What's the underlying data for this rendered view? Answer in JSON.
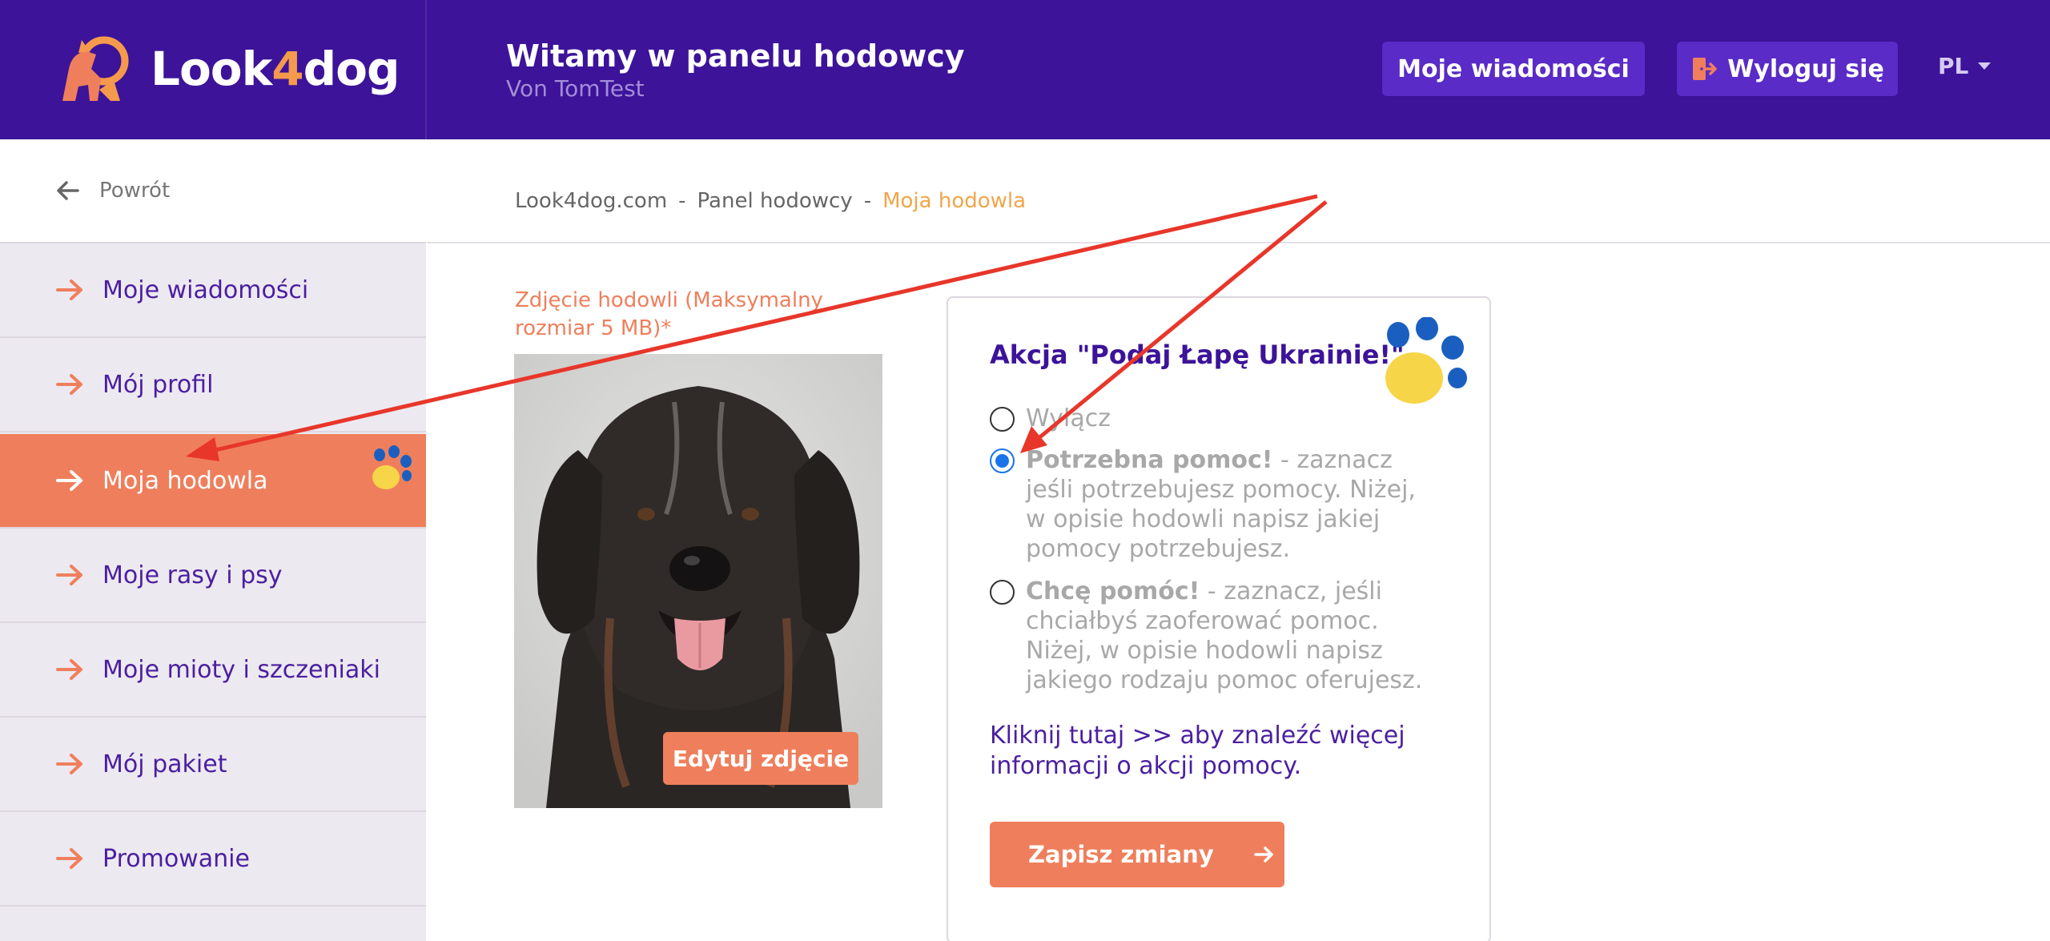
{
  "header": {
    "logo_text_a": "Look",
    "logo_text_b": "4",
    "logo_text_c": "dog",
    "welcome_title": "Witamy w panelu hodowcy",
    "welcome_sub": "Von TomTest",
    "messages_button": "Moje wiadomości",
    "logout_button": "Wyloguj się",
    "language": "PL"
  },
  "sidebar": {
    "back_label": "Powrót",
    "items": [
      {
        "label": "Moje wiadomości"
      },
      {
        "label": "Mój profil"
      },
      {
        "label": "Moja hodowla"
      },
      {
        "label": "Moje rasy i psy"
      },
      {
        "label": "Moje mioty i szczeniaki"
      },
      {
        "label": "Mój pakiet"
      },
      {
        "label": "Promowanie"
      }
    ]
  },
  "breadcrumb": {
    "items": [
      "Look4dog.com",
      "-",
      "Panel hodowcy",
      "-"
    ],
    "current": "Moja hodowla"
  },
  "photo": {
    "label": "Zdjęcie hodowli (Maksymalny rozmiar 5 MB)*",
    "edit_button": "Edytuj zdjęcie"
  },
  "ukraine_card": {
    "title": "Akcja \"Podaj Łapę Ukrainie!\"",
    "options": [
      {
        "bold": "",
        "text": "Wyłącz",
        "checked": false
      },
      {
        "bold": "Potrzebna pomoc!",
        "text": " - zaznacz jeśli potrzebujesz pomocy. Niżej, w opisie hodowli napisz jakiej pomocy potrzebujesz.",
        "checked": true
      },
      {
        "bold": "Chcę pomóc!",
        "text": " - zaznacz, jeśli chciałbyś zaoferować pomoc. Niżej, w opisie hodowli napisz jakiego rodzaju pomoc oferujesz.",
        "checked": false
      }
    ],
    "more_link": "Kliknij tutaj >> aby znaleźć więcej informacji o akcji pomocy.",
    "save_button": "Zapisz zmiany"
  },
  "colors": {
    "header_bg": "#3c1399",
    "accent_orange": "#ef7f5c",
    "nav_text": "#4a1fa0",
    "breadcrumb_current": "#f0a64b",
    "paw_yellow": "#f7d548",
    "paw_blue": "#1a5fbf",
    "annotation_red": "#e8362a"
  },
  "icons": {
    "logo": "dog-logo-icon",
    "logout": "exit-door-icon",
    "back": "arrow-left-icon",
    "nav": "arrow-right-icon",
    "paw": "ukraine-paw-icon"
  }
}
